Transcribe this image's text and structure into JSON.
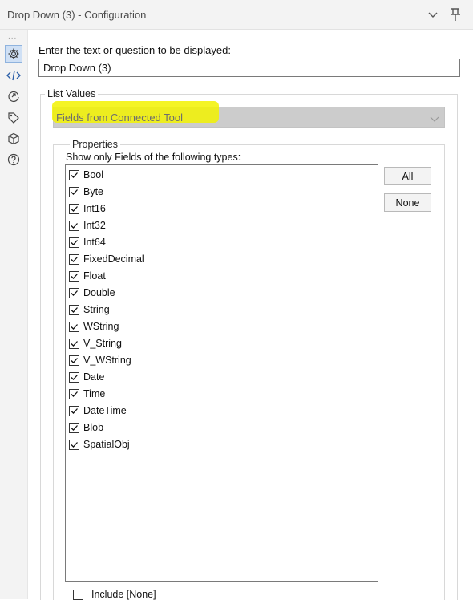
{
  "titlebar": {
    "title": "Drop Down (3) - Configuration",
    "collapse_icon": "chevron-down-icon",
    "pin_icon": "pin-icon"
  },
  "sidebar": {
    "overflow": "...",
    "icons": [
      "gear-icon",
      "code-icon",
      "tool-output-icon",
      "tag-icon",
      "cube-icon",
      "help-icon"
    ],
    "active": "gear-icon"
  },
  "prompt": {
    "label": "Enter the text or question to be displayed:",
    "value": "Drop Down (3)"
  },
  "list_values": {
    "legend": "List Values",
    "selected": "Fields from Connected Tool",
    "highlight_color": "#f2f200"
  },
  "properties": {
    "legend": "Properties",
    "types_label": "Show only Fields of the following types:",
    "types": [
      {
        "label": "Bool",
        "checked": true
      },
      {
        "label": "Byte",
        "checked": true
      },
      {
        "label": "Int16",
        "checked": true
      },
      {
        "label": "Int32",
        "checked": true
      },
      {
        "label": "Int64",
        "checked": true
      },
      {
        "label": "FixedDecimal",
        "checked": true
      },
      {
        "label": "Float",
        "checked": true
      },
      {
        "label": "Double",
        "checked": true
      },
      {
        "label": "String",
        "checked": true
      },
      {
        "label": "WString",
        "checked": true
      },
      {
        "label": "V_String",
        "checked": true
      },
      {
        "label": "V_WString",
        "checked": true
      },
      {
        "label": "Date",
        "checked": true
      },
      {
        "label": "Time",
        "checked": true
      },
      {
        "label": "DateTime",
        "checked": true
      },
      {
        "label": "Blob",
        "checked": true
      },
      {
        "label": "SpatialObj",
        "checked": true
      }
    ],
    "all_button": "All",
    "none_button": "None",
    "include_none": {
      "label": "Include [None]",
      "checked": false
    }
  }
}
